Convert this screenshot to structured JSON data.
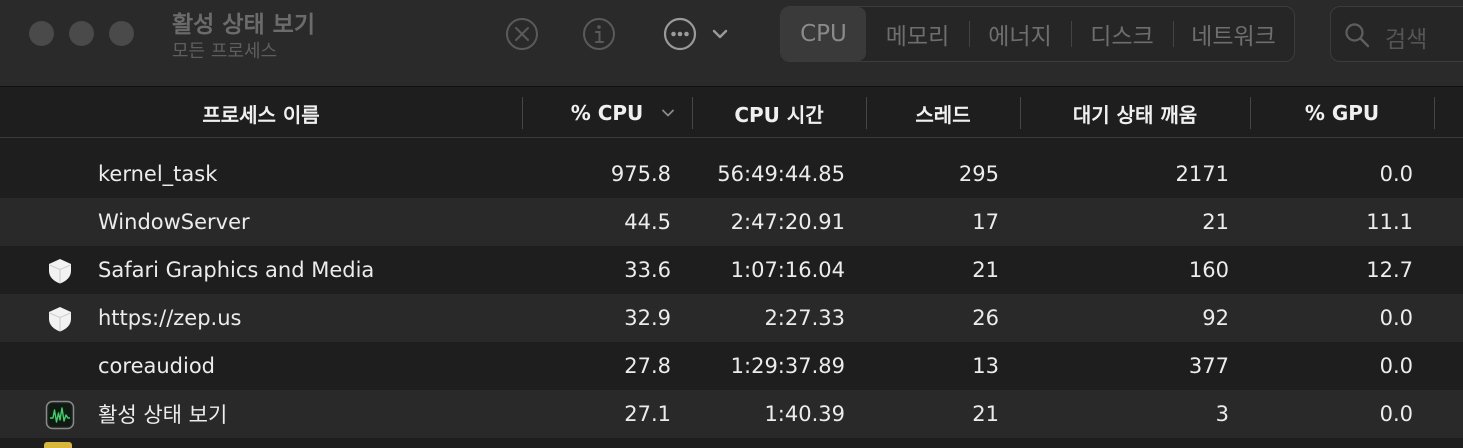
{
  "window": {
    "title": "활성 상태 보기",
    "subtitle": "모든 프로세스"
  },
  "toolbar": {
    "stop_icon": "xmark-circle-icon",
    "info_icon": "info-circle-icon",
    "more_icon": "ellipsis-circle-icon",
    "tabs": [
      {
        "label": "CPU",
        "active": true
      },
      {
        "label": "메모리",
        "active": false
      },
      {
        "label": "에너지",
        "active": false
      },
      {
        "label": "디스크",
        "active": false
      },
      {
        "label": "네트워크",
        "active": false
      }
    ],
    "search_placeholder": "검색"
  },
  "columns": [
    "프로세스 이름",
    "% CPU",
    "CPU 시간",
    "스레드",
    "대기 상태 깨움",
    "% GPU"
  ],
  "rows": [
    {
      "name": "kernel_task",
      "cpu": "975.8",
      "cpu_time": "56:49:44.85",
      "threads": "295",
      "wakeups": "2171",
      "gpu": "0.0",
      "icon": ""
    },
    {
      "name": "WindowServer",
      "cpu": "44.5",
      "cpu_time": "2:47:20.91",
      "threads": "17",
      "wakeups": "21",
      "gpu": "11.1",
      "icon": ""
    },
    {
      "name": "Safari Graphics and Media",
      "cpu": "33.6",
      "cpu_time": "1:07:16.04",
      "threads": "21",
      "wakeups": "160",
      "gpu": "12.7",
      "icon": "shield-icon"
    },
    {
      "name": "https://zep.us",
      "cpu": "32.9",
      "cpu_time": "2:27.33",
      "threads": "26",
      "wakeups": "92",
      "gpu": "0.0",
      "icon": "shield-icon"
    },
    {
      "name": "coreaudiod",
      "cpu": "27.8",
      "cpu_time": "1:29:37.89",
      "threads": "13",
      "wakeups": "377",
      "gpu": "0.0",
      "icon": ""
    },
    {
      "name": "활성 상태 보기",
      "cpu": "27.1",
      "cpu_time": "1:40.39",
      "threads": "21",
      "wakeups": "3",
      "gpu": "0.0",
      "icon": "activity-monitor-icon"
    }
  ]
}
